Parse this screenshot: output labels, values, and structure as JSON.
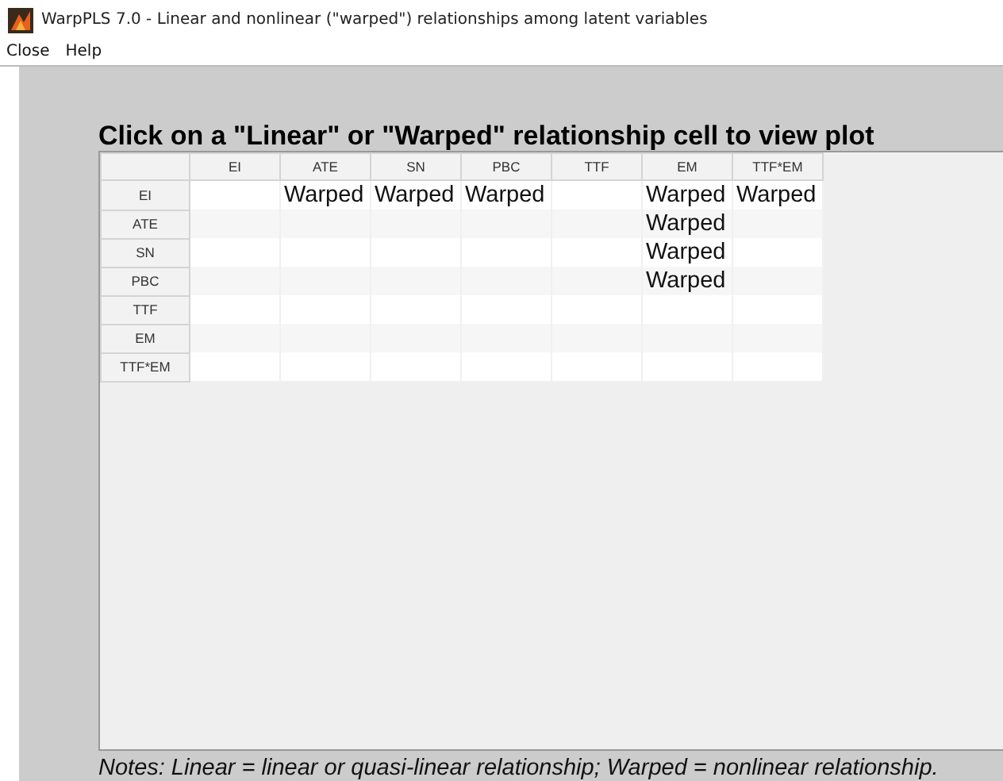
{
  "window": {
    "title": "WarpPLS 7.0 - Linear and nonlinear (\"warped\") relationships among latent variables"
  },
  "menu": [
    "Close",
    "Help"
  ],
  "heading": "Click on a \"Linear\" or \"Warped\" relationship cell to view plot",
  "table": {
    "columns": [
      "EI",
      "ATE",
      "SN",
      "PBC",
      "TTF",
      "EM",
      "TTF*EM"
    ],
    "rows": [
      {
        "label": "EI",
        "cells": [
          null,
          "Warped",
          "Warped",
          "Warped",
          null,
          "Warped",
          "Warped"
        ]
      },
      {
        "label": "ATE",
        "cells": [
          null,
          null,
          null,
          null,
          null,
          "Warped",
          null
        ]
      },
      {
        "label": "SN",
        "cells": [
          null,
          null,
          null,
          null,
          null,
          "Warped",
          null
        ]
      },
      {
        "label": "PBC",
        "cells": [
          null,
          null,
          null,
          null,
          null,
          "Warped",
          null
        ]
      },
      {
        "label": "TTF",
        "cells": [
          null,
          null,
          null,
          null,
          null,
          null,
          null
        ]
      },
      {
        "label": "EM",
        "cells": [
          null,
          null,
          null,
          null,
          null,
          null,
          null
        ]
      },
      {
        "label": "TTF*EM",
        "cells": [
          null,
          null,
          null,
          null,
          null,
          null,
          null
        ]
      }
    ]
  },
  "notes": "Notes: Linear = linear or quasi-linear relationship; Warped = nonlinear relationship."
}
